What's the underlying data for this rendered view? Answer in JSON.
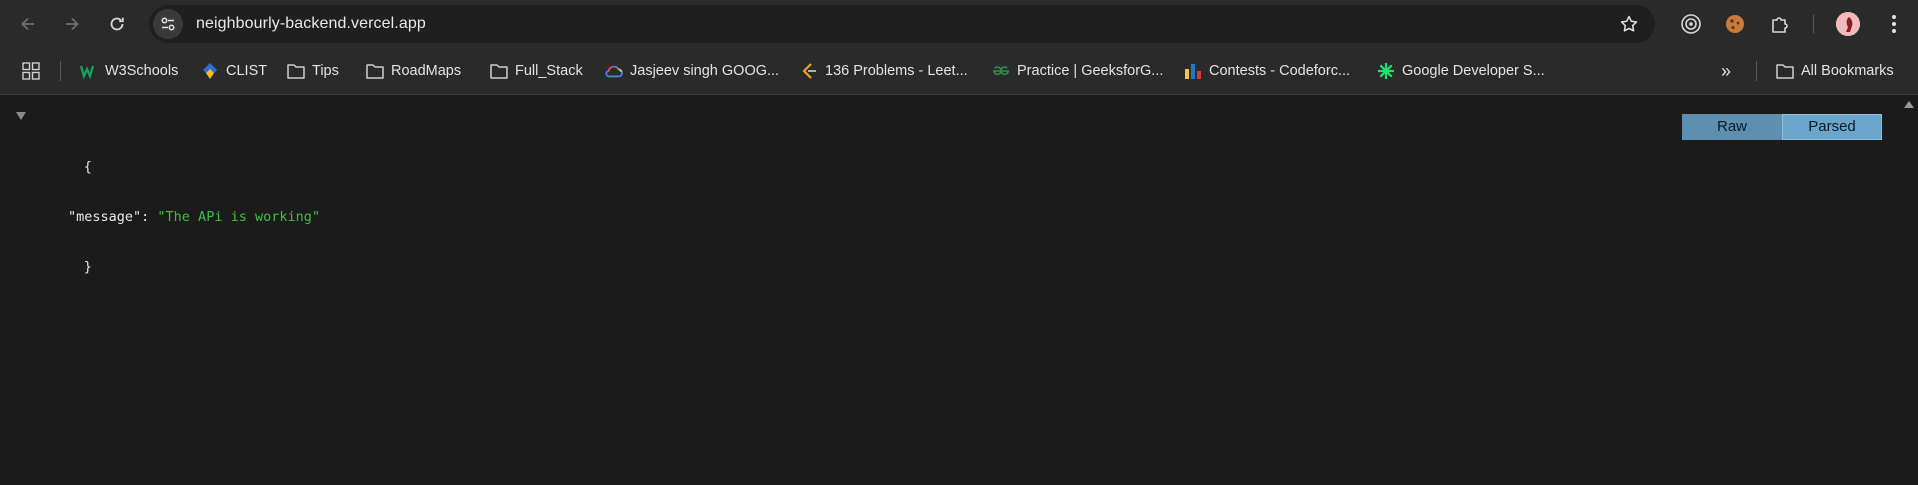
{
  "browser": {
    "url": "neighbourly-backend.vercel.app",
    "icons": {
      "back": "arrow-left-icon",
      "forward": "arrow-right-icon",
      "reload": "reload-icon",
      "site_info": "tune-icon",
      "bookmark_star": "star-icon",
      "extensions": [
        "target-icon",
        "cookie-icon",
        "puzzle-icon"
      ],
      "menu": "kebab-menu-icon"
    }
  },
  "bookmarks": {
    "items": [
      {
        "label": "W3Schools",
        "icon": "w3schools-icon"
      },
      {
        "label": "CLIST",
        "icon": "clist-icon"
      },
      {
        "label": "Tips",
        "icon": "folder-icon"
      },
      {
        "label": "RoadMaps",
        "icon": "folder-icon"
      },
      {
        "label": "Full_Stack",
        "icon": "folder-icon"
      },
      {
        "label": "Jasjeev singh GOOG...",
        "icon": "google-cloud-icon"
      },
      {
        "label": "136 Problems - Leet...",
        "icon": "leetcode-icon"
      },
      {
        "label": "Practice | GeeksforG...",
        "icon": "geeksforgeeks-icon"
      },
      {
        "label": "Contests - Codeforc...",
        "icon": "codeforces-icon"
      },
      {
        "label": "Google Developer S...",
        "icon": "google-developer-icon"
      }
    ],
    "overflow": "»",
    "all_bookmarks": "All Bookmarks"
  },
  "json_viewer": {
    "open_brace": "{",
    "close_brace": "}",
    "key": "\"message\"",
    "colon": ": ",
    "value": "\"The APi is working\"",
    "raw_label": "Raw",
    "parsed_label": "Parsed"
  },
  "colors": {
    "string_value": "#3fbf3f",
    "button": "#5e8fb0",
    "button_active": "#6aa6cc"
  }
}
